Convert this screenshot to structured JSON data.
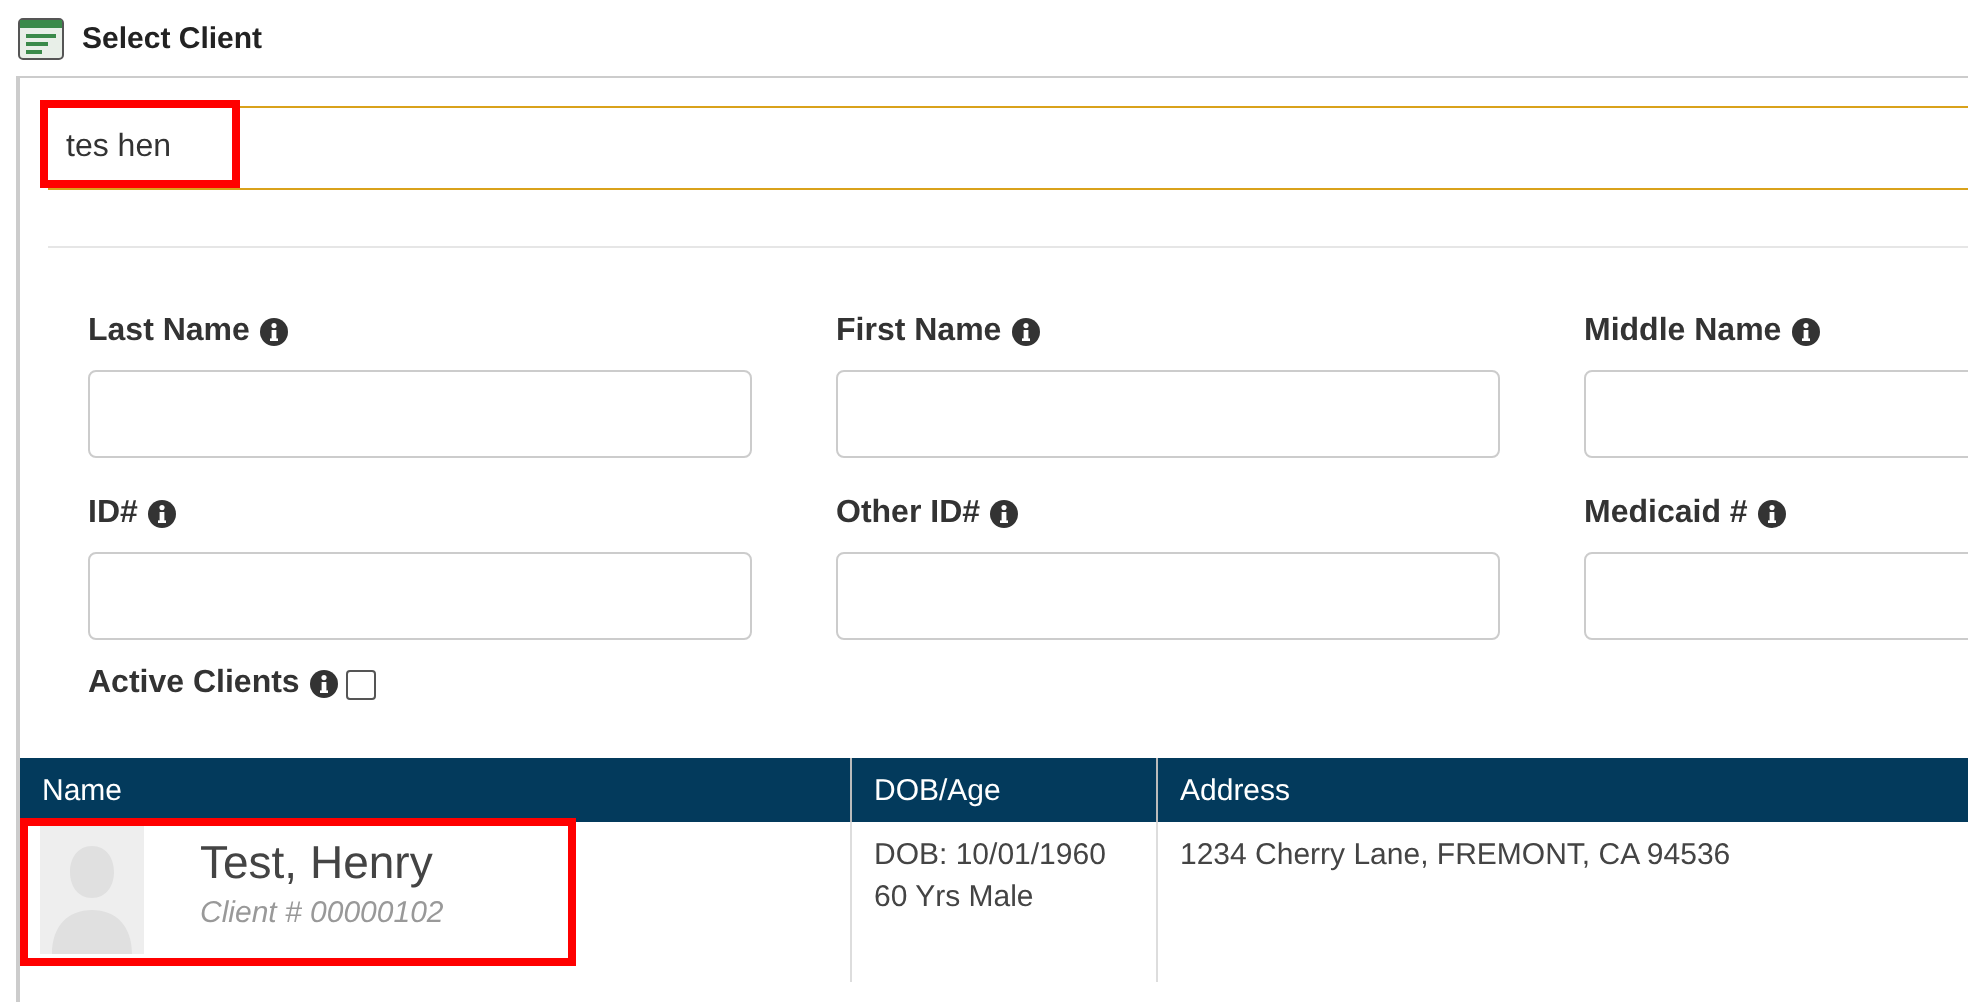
{
  "window": {
    "title": "Select Client"
  },
  "search": {
    "value": "tes hen",
    "highlighted": true
  },
  "filters": [
    {
      "label": "Last Name"
    },
    {
      "label": "First Name"
    },
    {
      "label": "Middle Name"
    },
    {
      "label": "ID#"
    },
    {
      "label": "Other ID#"
    },
    {
      "label": "Medicaid #"
    }
  ],
  "active_clients": {
    "label": "Active Clients",
    "checked": false
  },
  "table": {
    "columns": [
      "Name",
      "DOB/Age",
      "Address"
    ],
    "rows": [
      {
        "name": "Test, Henry",
        "client_number": "Client # 00000102",
        "dob": "DOB: 10/01/1960",
        "age_sex": "60 Yrs Male",
        "address": "1234 Cherry Lane, FREMONT, CA 94536",
        "highlighted": true
      }
    ]
  }
}
